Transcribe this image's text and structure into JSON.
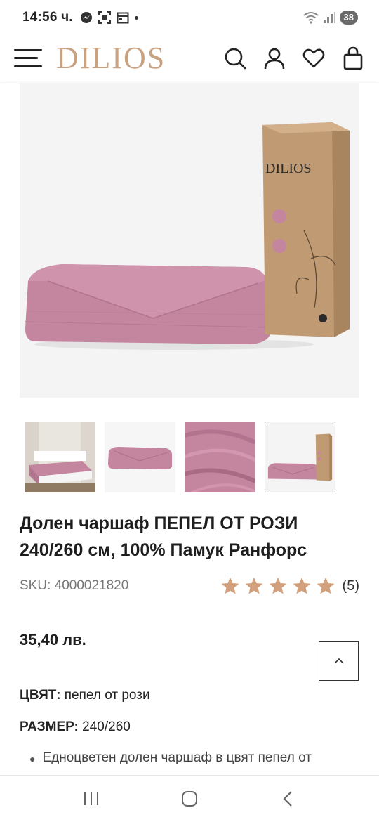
{
  "status_bar": {
    "time": "14:56 ч.",
    "battery": "38",
    "icons": [
      "messenger-icon",
      "scan-icon",
      "calendar-icon",
      "wifi-icon",
      "signal-icon"
    ]
  },
  "header": {
    "logo": "DILIOS",
    "icons": [
      "menu-icon",
      "search-icon",
      "account-icon",
      "wishlist-icon",
      "cart-icon"
    ]
  },
  "gallery": {
    "box_brand": "DILIOS",
    "thumbnails": [
      "bed-photo",
      "folded-sheet",
      "fabric-closeup",
      "sheet-with-box"
    ],
    "active_index": 3
  },
  "product": {
    "title": "Долен чаршаф ПЕПЕЛ ОТ РОЗИ 240/260 см, 100% Памук Ранфорс",
    "sku": "SKU: 4000021820",
    "rating": 5,
    "review_count": "(5)",
    "price": "35,40 лв.",
    "color_label": "ЦВЯТ:",
    "color_value": "пепел от рози",
    "size_label": "РАЗМЕР:",
    "size_value": "240/260",
    "bullet": "Едноцветен долен чаршаф в цвят пепел от"
  },
  "colors": {
    "brand_gold": "#c8a383",
    "star": "#d2a07c",
    "sheet_pink": "#c4859f"
  },
  "nav": [
    "recents-icon",
    "home-icon",
    "back-icon"
  ]
}
